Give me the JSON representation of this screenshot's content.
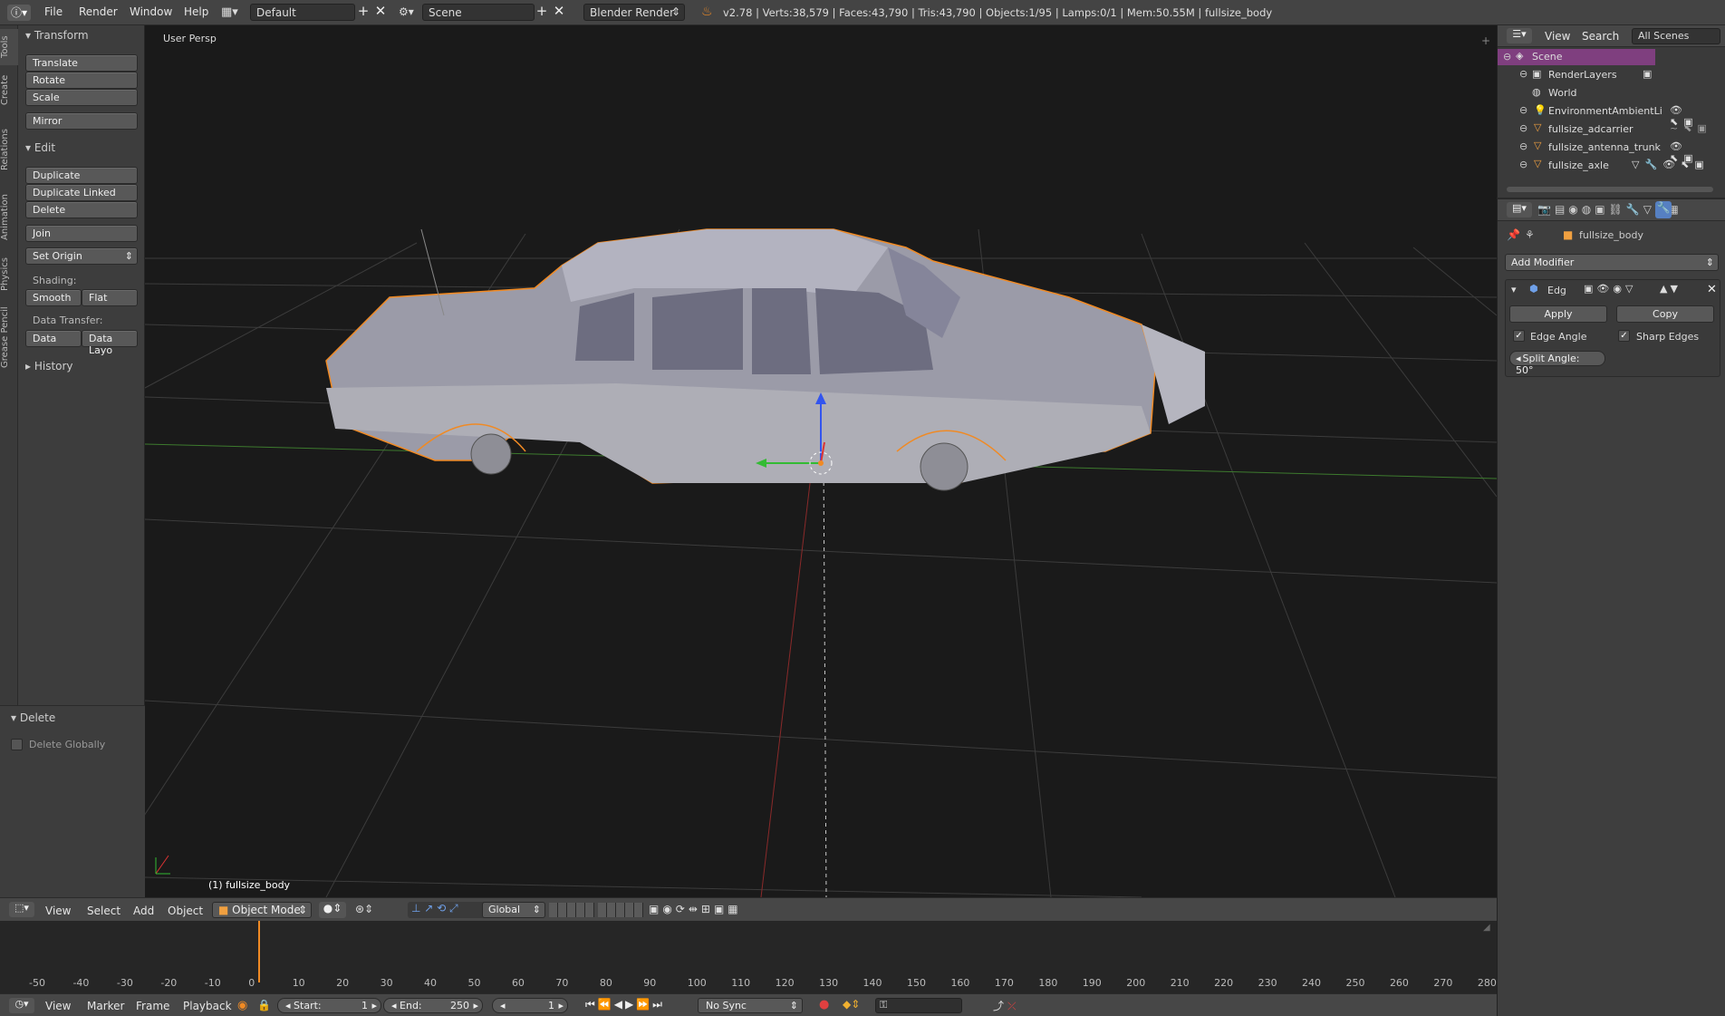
{
  "header": {
    "menus": [
      "File",
      "Render",
      "Window",
      "Help"
    ],
    "layout": "Default",
    "scene": "Scene",
    "engine": "Blender Render",
    "stats": "v2.78 | Verts:38,579 | Faces:43,790 | Tris:43,790 | Objects:1/95 | Lamps:0/1 | Mem:50.55M | fullsize_body"
  },
  "tabs": [
    "Tools",
    "Create",
    "Relations",
    "Animation",
    "Physics",
    "Grease Pencil"
  ],
  "toolshelf": {
    "transform": "Transform",
    "translate": "Translate",
    "rotate": "Rotate",
    "scale": "Scale",
    "mirror": "Mirror",
    "edit": "Edit",
    "duplicate": "Duplicate",
    "duplicate_linked": "Duplicate Linked",
    "delete": "Delete",
    "join": "Join",
    "set_origin": "Set Origin",
    "shading": "Shading:",
    "smooth": "Smooth",
    "flat": "Flat",
    "data_transfer": "Data Transfer:",
    "data": "Data",
    "data_layout": "Data Layo",
    "history": "History",
    "delete_panel": "Delete",
    "delete_globally": "Delete Globally"
  },
  "viewport": {
    "label": "User Persp",
    "object_label": "(1) fullsize_body"
  },
  "view_header": {
    "menus": [
      "View",
      "Select",
      "Add",
      "Object"
    ],
    "mode": "Object Mode",
    "orientation": "Global"
  },
  "timeline": {
    "ticks": [
      "-50",
      "-40",
      "-30",
      "-20",
      "-10",
      "0",
      "10",
      "20",
      "30",
      "40",
      "50",
      "60",
      "70",
      "80",
      "90",
      "100",
      "110",
      "120",
      "130",
      "140",
      "150",
      "160",
      "170",
      "180",
      "190",
      "200",
      "210",
      "220",
      "230",
      "240",
      "250",
      "260",
      "270",
      "280"
    ],
    "current_frame": 0,
    "menus": [
      "View",
      "Marker",
      "Frame",
      "Playback"
    ],
    "start_label": "Start:",
    "start": "1",
    "end_label": "End:",
    "end": "250",
    "frame": "1",
    "sync": "No Sync"
  },
  "outliner": {
    "menus": [
      "View",
      "Search"
    ],
    "filter": "All Scenes",
    "items": [
      "Scene",
      "RenderLayers",
      "World",
      "EnvironmentAmbientLi",
      "fullsize_adcarrier",
      "fullsize_antenna_trunk",
      "fullsize_axle"
    ]
  },
  "properties": {
    "object": "fullsize_body",
    "add_modifier": "Add Modifier",
    "modifier_name": "Edg",
    "apply": "Apply",
    "copy": "Copy",
    "edge_angle": "Edge Angle",
    "sharp_edges": "Sharp Edges",
    "split_angle": "Split Angle: 50°"
  },
  "colors": {
    "accent": "#f08a24",
    "selection": "#7f3f7f",
    "active_tab": "#5680c2"
  }
}
